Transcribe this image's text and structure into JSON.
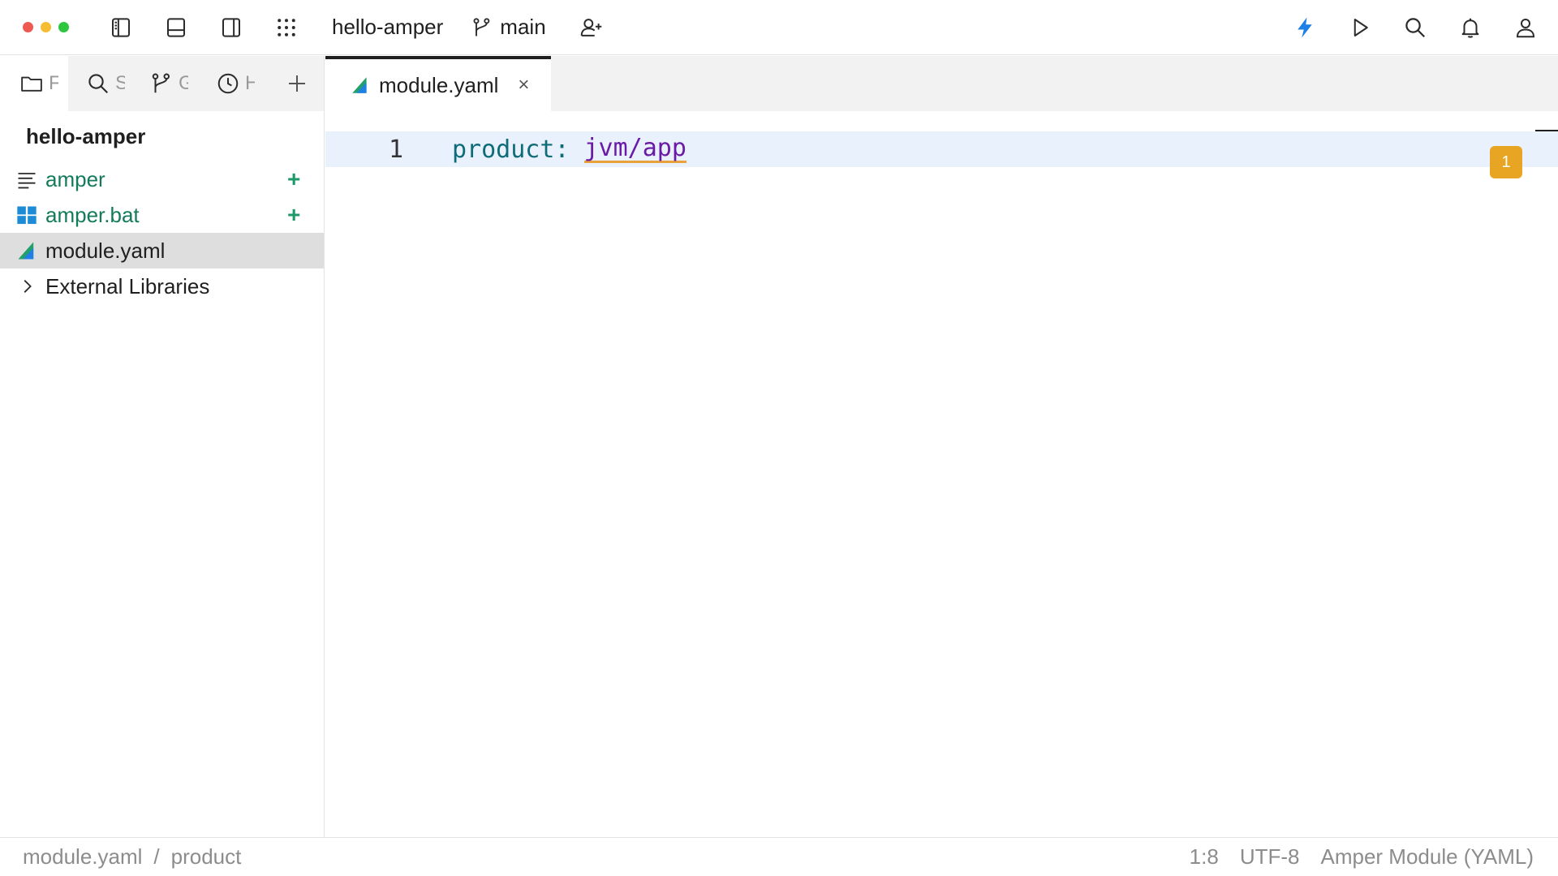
{
  "titlebar": {
    "project": "hello-amper",
    "branch": "main"
  },
  "sidebar": {
    "tabs": [
      {
        "label": "F",
        "icon": "folder-icon"
      },
      {
        "label": "S",
        "icon": "search-icon"
      },
      {
        "label": "G",
        "icon": "git-branch-icon"
      },
      {
        "label": "H",
        "icon": "clock-icon"
      }
    ],
    "root": "hello-amper",
    "items": [
      {
        "name": "amper",
        "icon": "text-file-icon",
        "status": "+"
      },
      {
        "name": "amper.bat",
        "icon": "windows-icon",
        "status": "+"
      },
      {
        "name": "module.yaml",
        "icon": "amper-module-icon"
      },
      {
        "name": "External Libraries",
        "icon": "chevron-right-icon"
      }
    ]
  },
  "editor": {
    "tab": {
      "label": "module.yaml",
      "close": "×"
    },
    "lines": [
      {
        "number": "1",
        "key": "product",
        "colon": ":",
        "value": "jvm/app"
      }
    ],
    "problems": "1"
  },
  "statusbar": {
    "breadcrumb": [
      "module.yaml",
      "/",
      "product"
    ],
    "position": "1:8",
    "encoding": "UTF-8",
    "filetype": "Amper Module (YAML)"
  },
  "colors": {
    "accent": "#1e7fe6",
    "vcs_added": "#137a5a",
    "warning": "#e8a524",
    "current_line": "#e8f1fc"
  }
}
